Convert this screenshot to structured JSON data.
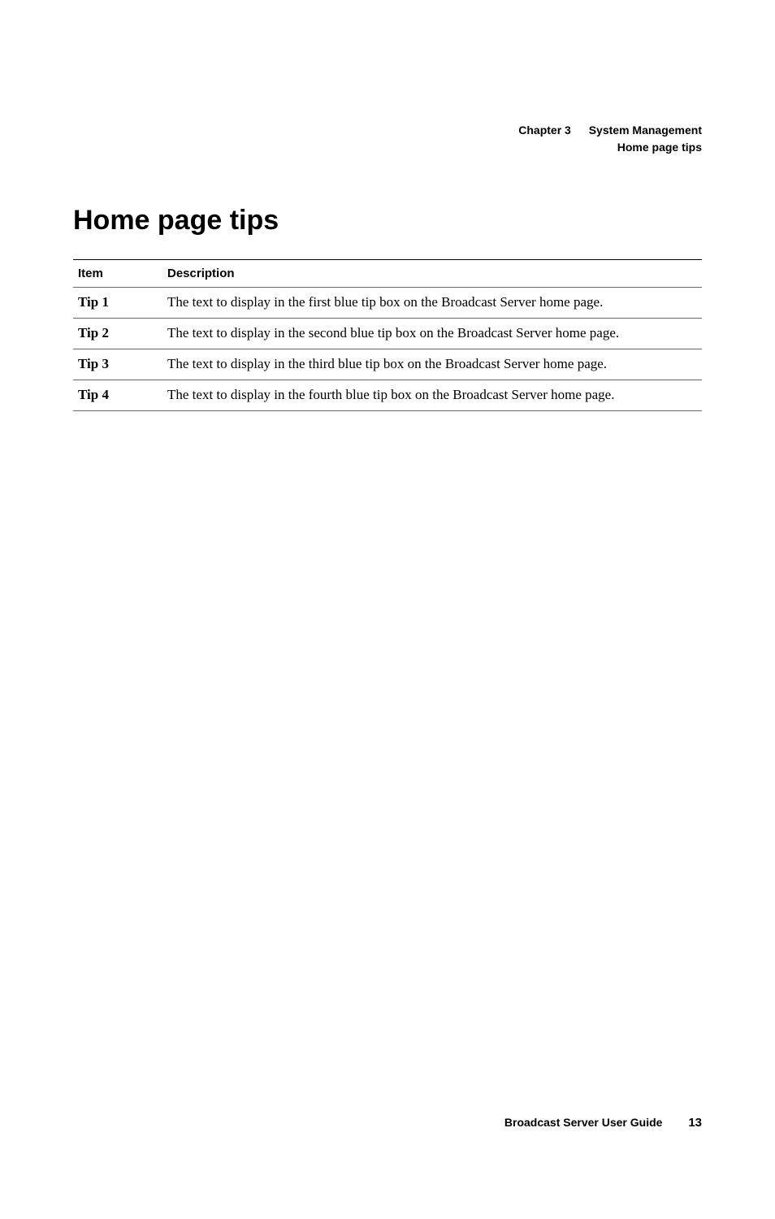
{
  "header": {
    "chapter_label": "Chapter 3",
    "chapter_title": "System Management",
    "subsection": "Home page tips"
  },
  "section_title": "Home page tips",
  "table": {
    "columns": {
      "item": "Item",
      "description": "Description"
    },
    "rows": [
      {
        "item": "Tip 1",
        "description": "The text to display in the first blue tip box on the Broadcast Server home page."
      },
      {
        "item": "Tip 2",
        "description": "The text to display in the second blue tip box on the Broadcast Server home page."
      },
      {
        "item": "Tip 3",
        "description": "The text to display in the third blue tip box on the Broadcast Server home page."
      },
      {
        "item": "Tip 4",
        "description": "The text to display in the fourth blue tip box on the Broadcast Server home page."
      }
    ]
  },
  "footer": {
    "doc_title": "Broadcast Server User Guide",
    "page_number": "13"
  }
}
